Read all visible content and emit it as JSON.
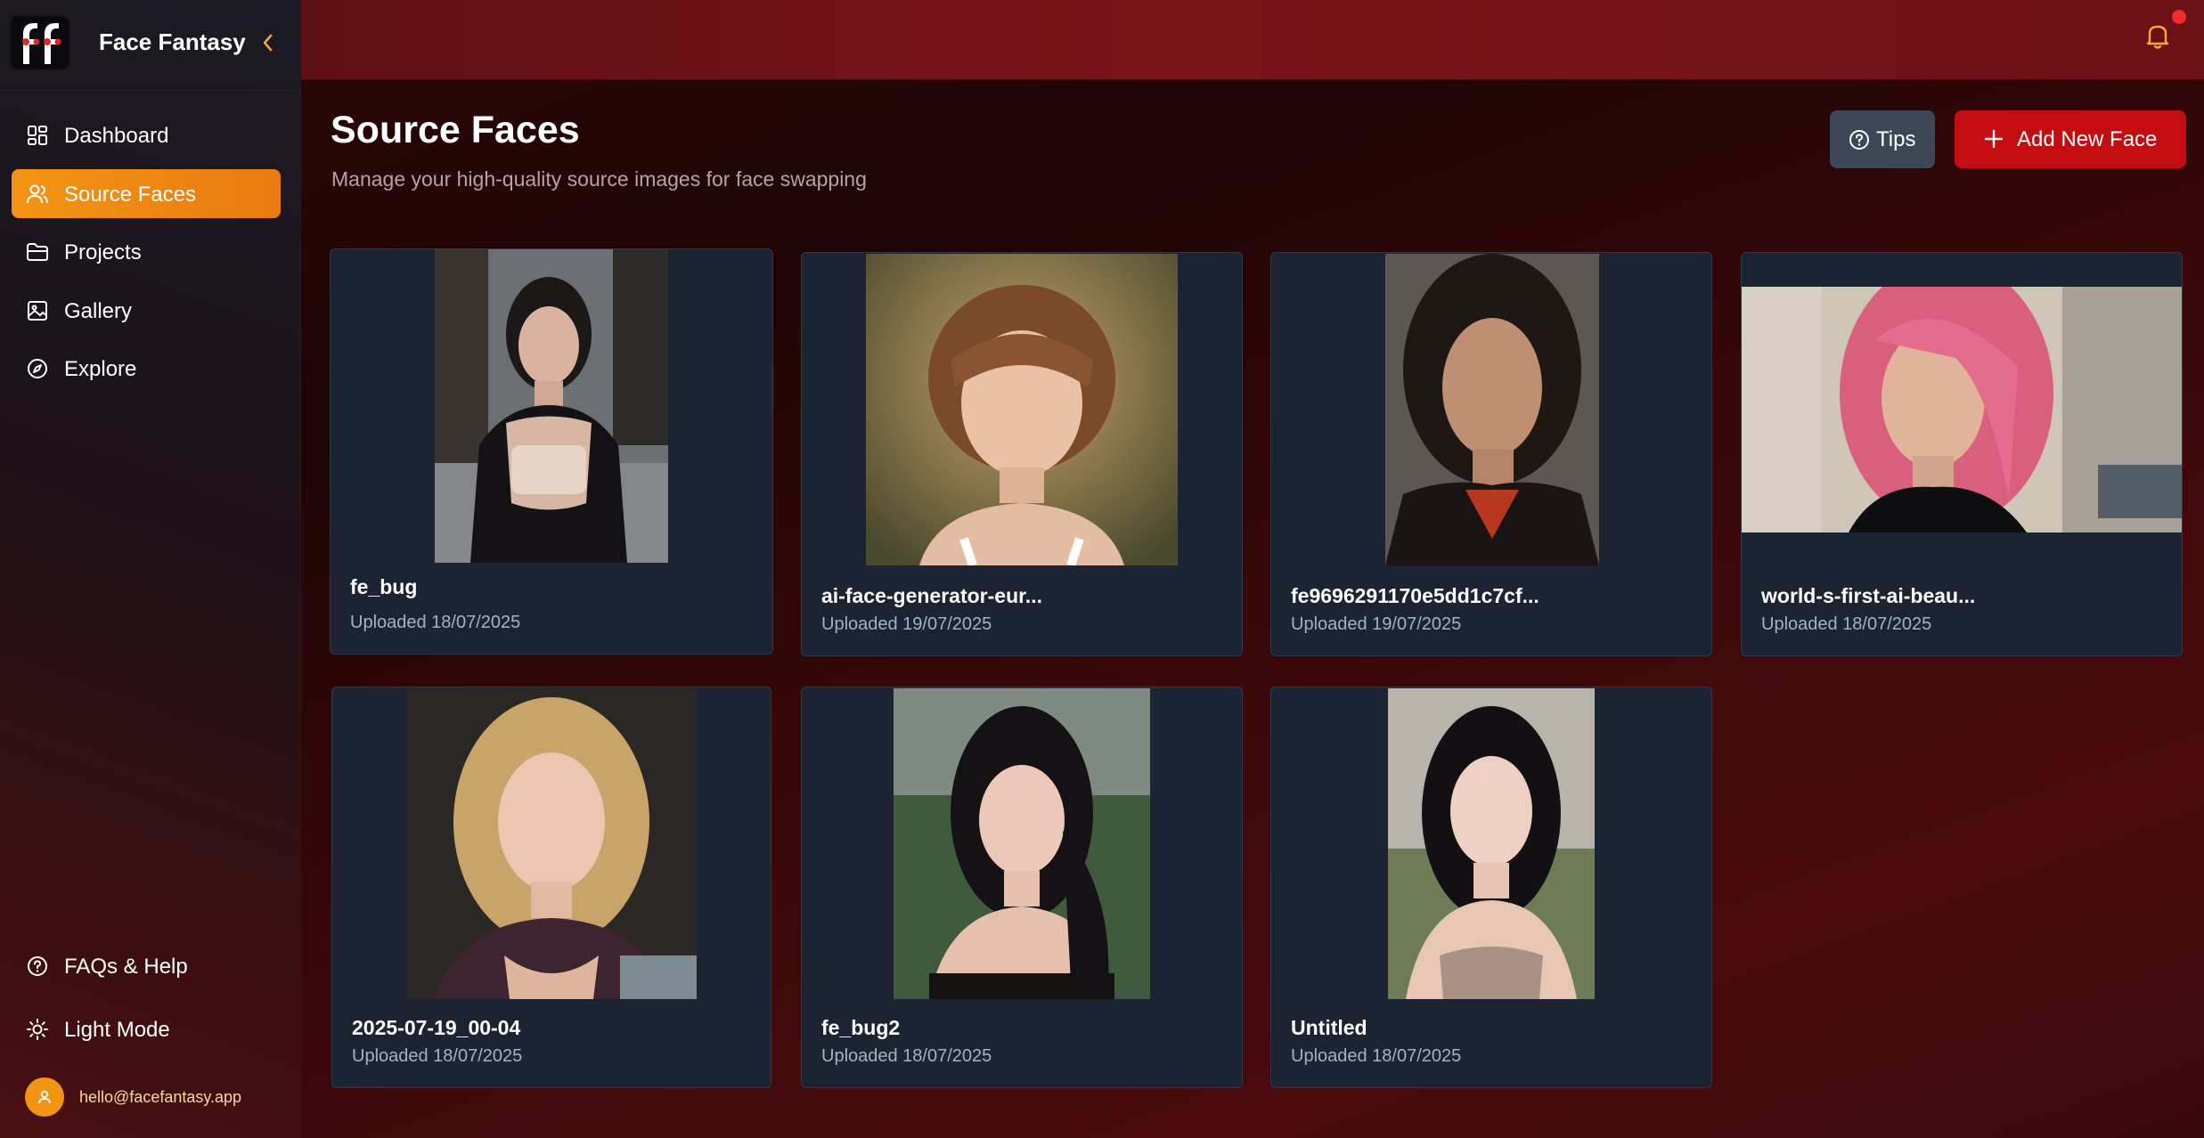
{
  "app": {
    "name": "Face Fantasy"
  },
  "sidebar": {
    "items": [
      {
        "label": "Dashboard",
        "icon": "dashboard-icon"
      },
      {
        "label": "Source Faces",
        "icon": "users-icon",
        "active": true
      },
      {
        "label": "Projects",
        "icon": "folder-icon"
      },
      {
        "label": "Gallery",
        "icon": "image-icon"
      },
      {
        "label": "Explore",
        "icon": "compass-icon"
      }
    ],
    "bottom": [
      {
        "label": "FAQs & Help",
        "icon": "help-circle-icon"
      },
      {
        "label": "Light Mode",
        "icon": "sun-icon"
      }
    ],
    "user": {
      "email": "hello@facefantasy.app"
    }
  },
  "header": {
    "notifications": "unread"
  },
  "page": {
    "title": "Source Faces",
    "subtitle": "Manage your high-quality source images for face swapping"
  },
  "actions": {
    "tips_label": "Tips",
    "add_label": "Add New Face"
  },
  "faces": [
    {
      "title": "fe_bug",
      "date": "Uploaded 18/07/2025"
    },
    {
      "title": "ai-face-generator-eur...",
      "date": "Uploaded 19/07/2025"
    },
    {
      "title": "fe9696291170e5dd1c7cf...",
      "date": "Uploaded 19/07/2025"
    },
    {
      "title": "world-s-first-ai-beau...",
      "date": "Uploaded 18/07/2025"
    },
    {
      "title": "2025-07-19_00-04",
      "date": "Uploaded 18/07/2025"
    },
    {
      "title": "fe_bug2",
      "date": "Uploaded 18/07/2025"
    },
    {
      "title": "Untitled",
      "date": "Uploaded 18/07/2025"
    }
  ],
  "colors": {
    "accent": "#f39514",
    "primary_button": "#c40d10",
    "card_bg": "#1c2433",
    "notification_dot": "#ef2b2b"
  }
}
